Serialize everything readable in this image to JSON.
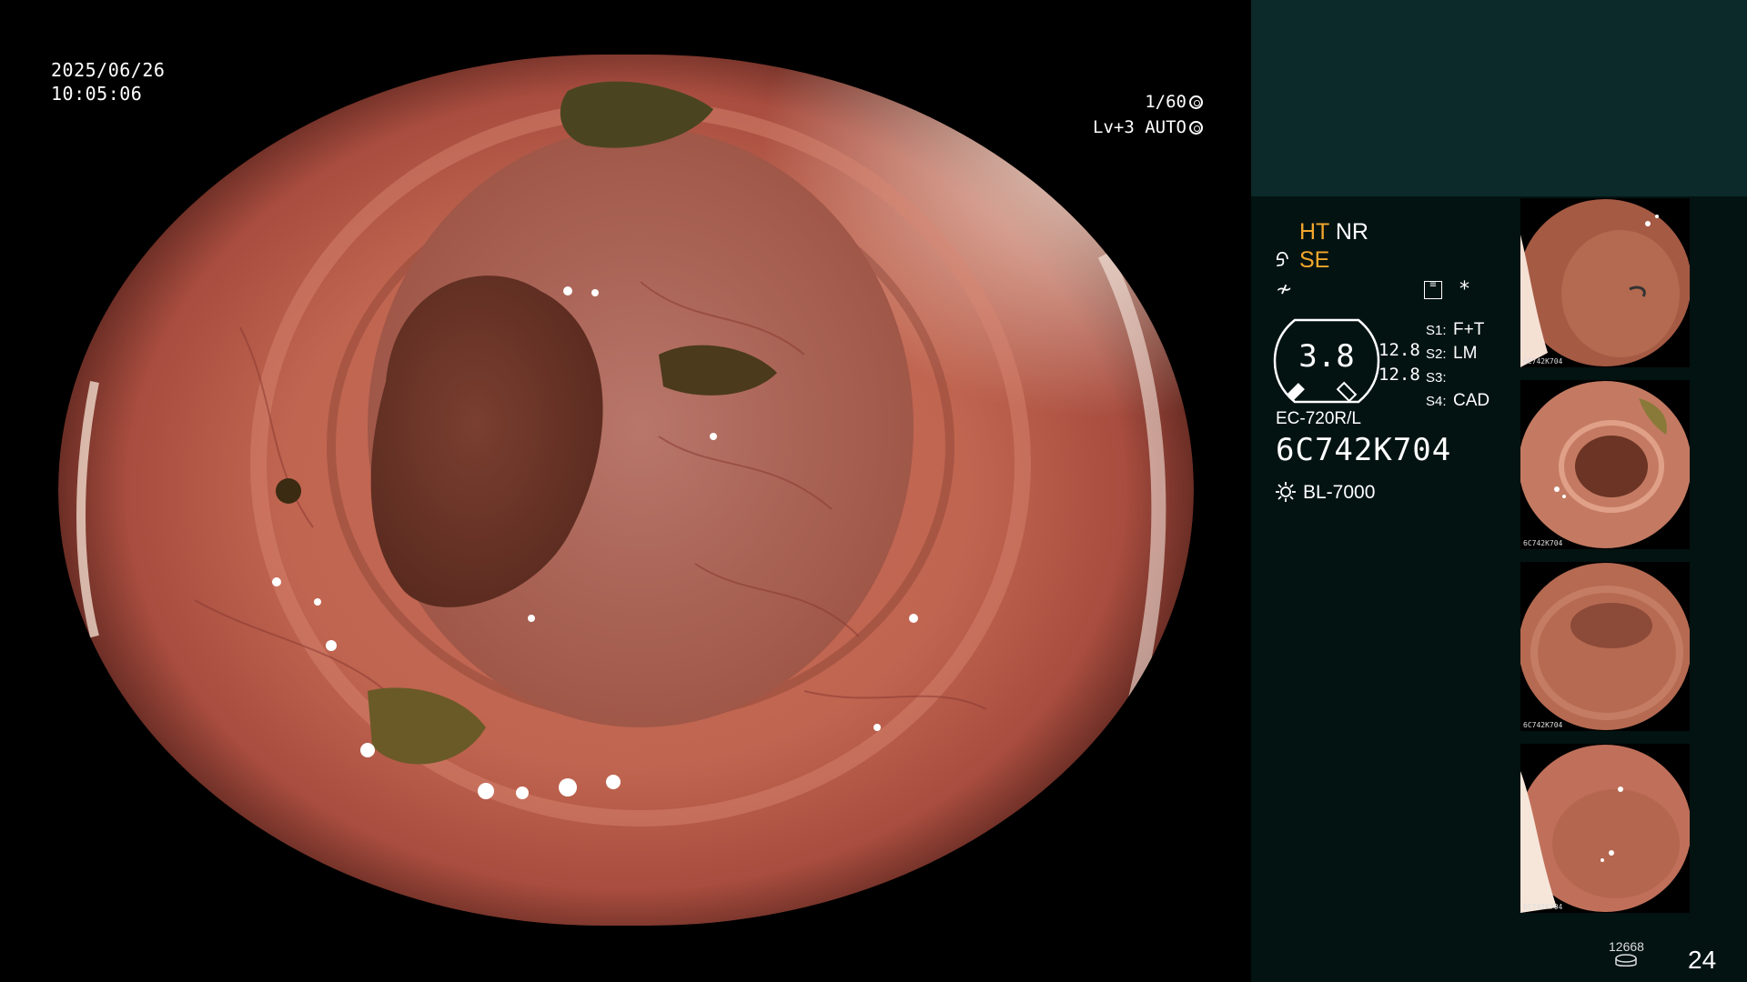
{
  "overlay": {
    "date": "2025/06/26",
    "time": "10:05:06",
    "shutter": "1/60",
    "level_auto": "Lv+3 AUTO"
  },
  "panel": {
    "modes": {
      "ht": "HT",
      "nr": "NR",
      "se": "SE"
    },
    "gauge_value": "3.8",
    "gauge_side_values": [
      "12.8",
      "12.8"
    ],
    "settings": [
      {
        "label": "S1:",
        "value": "F+T"
      },
      {
        "label": "S2:",
        "value": "LM"
      },
      {
        "label": "S3:",
        "value": ""
      },
      {
        "label": "S4:",
        "value": "CAD"
      }
    ],
    "scope_model": "EC-720R/L",
    "scope_serial": "6C742K704",
    "light_source": "BL-7000",
    "image_count": "12668",
    "page_count": "24"
  },
  "thumbnails": [
    {
      "caption": "6C742K704"
    },
    {
      "caption": "6C742K704"
    },
    {
      "caption": "6C742K704"
    },
    {
      "caption": "6C742K704"
    }
  ],
  "colors": {
    "accent_orange": "#f3a72c",
    "panel_bg": "#031312",
    "panel_top": "#0b2a29",
    "mucosa": "#c0685a"
  },
  "icons": [
    "shutter-icon",
    "auto-iris-icon",
    "structure-enhance-icon",
    "freeze-icon",
    "memo-icon",
    "star-icon",
    "light-source-icon",
    "disk-icon"
  ]
}
